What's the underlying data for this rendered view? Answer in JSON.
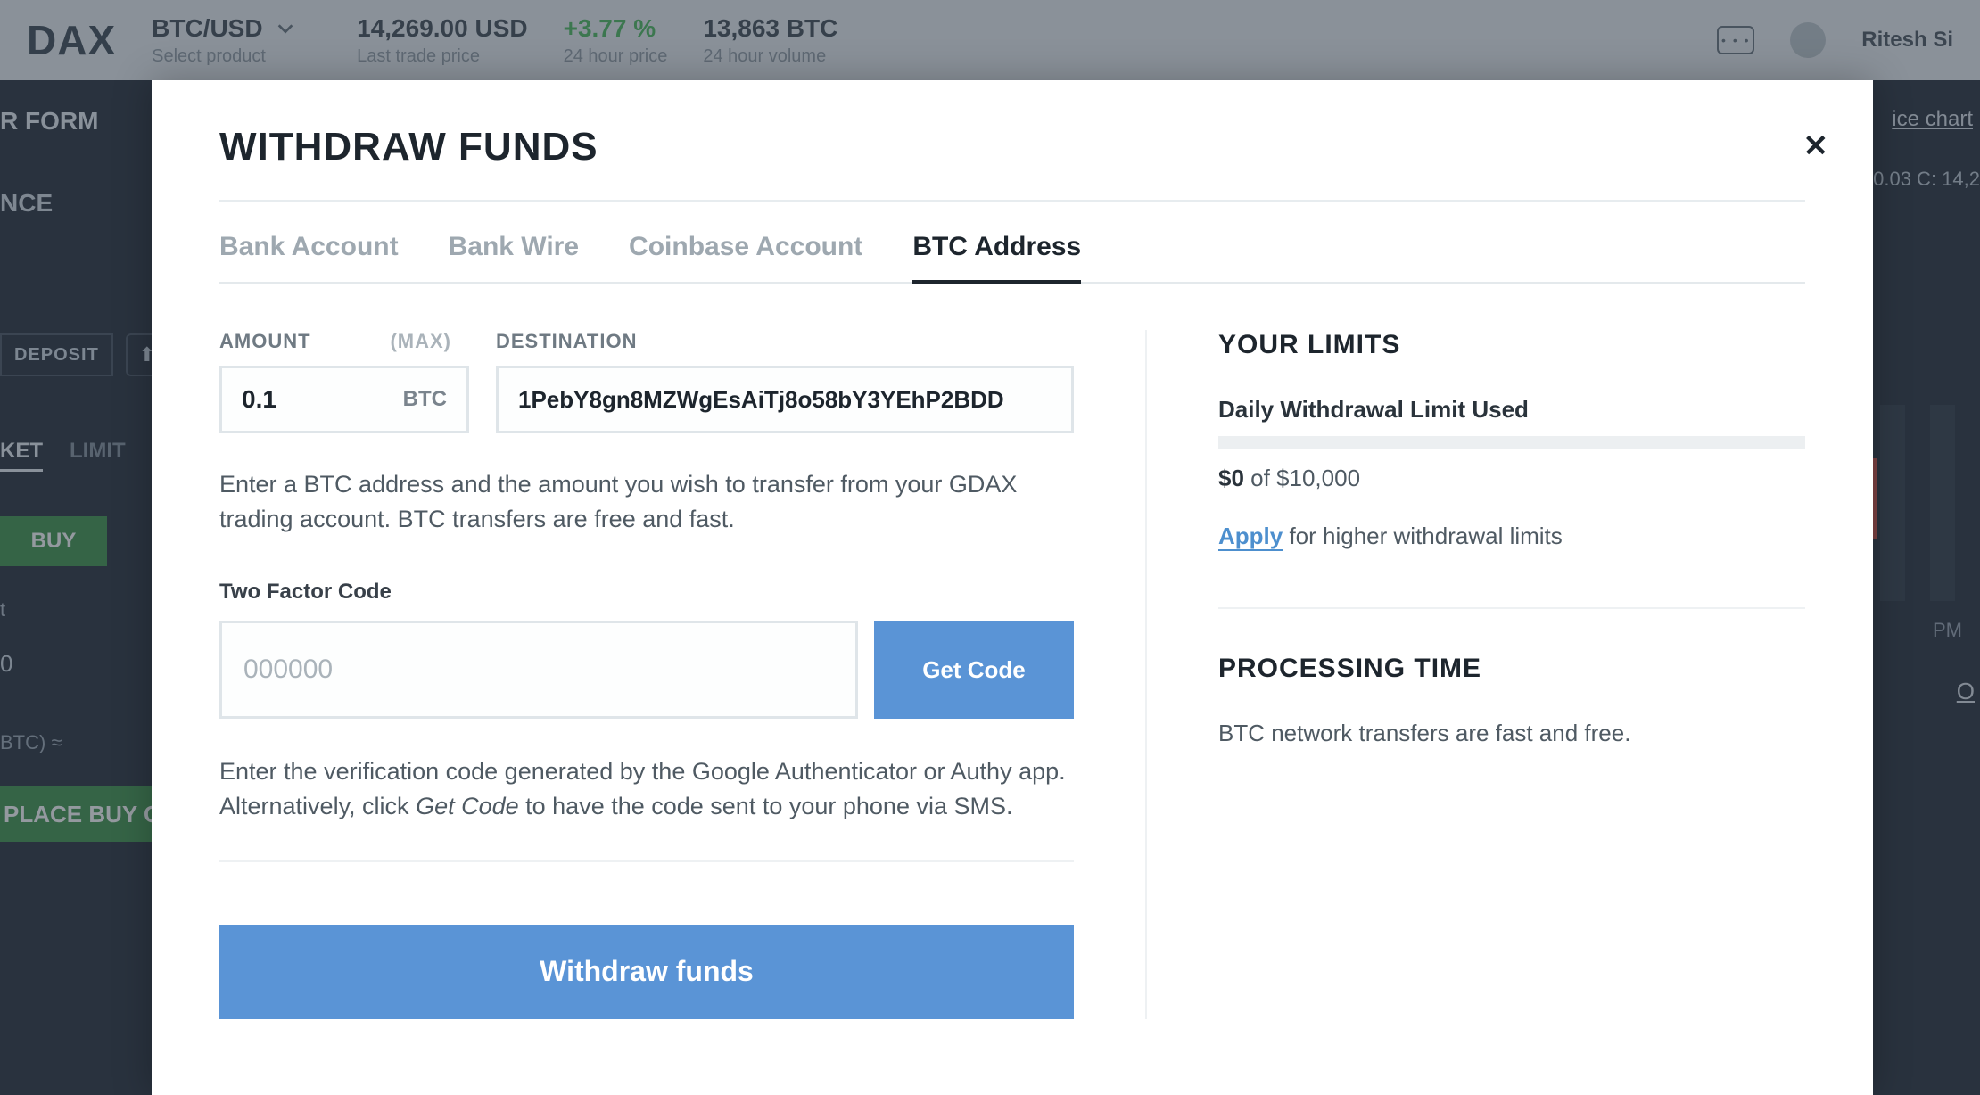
{
  "topbar": {
    "logo": "DAX",
    "selector": {
      "pair": "BTC/USD",
      "sub": "Select product"
    },
    "last_price": {
      "value": "14,269.00 USD",
      "sub": "Last trade price"
    },
    "change": {
      "value": "+3.77 %",
      "sub": "24 hour price"
    },
    "volume": {
      "value": "13,863 BTC",
      "sub": "24 hour volume"
    },
    "username": "Ritesh Si"
  },
  "sidebar": {
    "title": "R FORM",
    "balance_label": "NCE",
    "deposit": "DEPOSIT",
    "tabs": {
      "market": "KET",
      "limit": "LIMIT"
    },
    "buy": "BUY",
    "hint": "t",
    "zero": "0",
    "approx": "BTC) ≈",
    "place": "PLACE BUY O"
  },
  "right_edge": {
    "link": "ice chart",
    "ohlc": "0.03  C: 14,2",
    "time": "PM",
    "orders": "O"
  },
  "modal": {
    "title": "WITHDRAW FUNDS",
    "tabs": [
      "Bank Account",
      "Bank Wire",
      "Coinbase Account",
      "BTC Address"
    ],
    "active_tab_index": 3,
    "form": {
      "amount_label": "AMOUNT",
      "max_label": "(MAX)",
      "dest_label": "DESTINATION",
      "amount_value": "0.1",
      "amount_unit": "BTC",
      "destination_value": "1PebY8gn8MZWgEsAiTj8o58bY3YEhP2BDD",
      "help1": "Enter a BTC address and the amount you wish to transfer from your GDAX trading account. BTC transfers are free and fast.",
      "tfa_label": "Two Factor Code",
      "tfa_placeholder": "000000",
      "getcode": "Get Code",
      "help2_a": "Enter the verification code generated by the Google Authenticator or Authy app. Alternatively, click ",
      "help2_em": "Get Code",
      "help2_b": " to have the code sent to your phone via SMS.",
      "submit": "Withdraw funds"
    },
    "limits": {
      "heading": "YOUR LIMITS",
      "label": "Daily Withdrawal Limit Used",
      "used": "$0",
      "of": " of $10,000",
      "apply": "Apply",
      "apply_rest": " for higher withdrawal limits",
      "proc_heading": "PROCESSING TIME",
      "proc_text": "BTC network transfers are fast and free."
    }
  }
}
